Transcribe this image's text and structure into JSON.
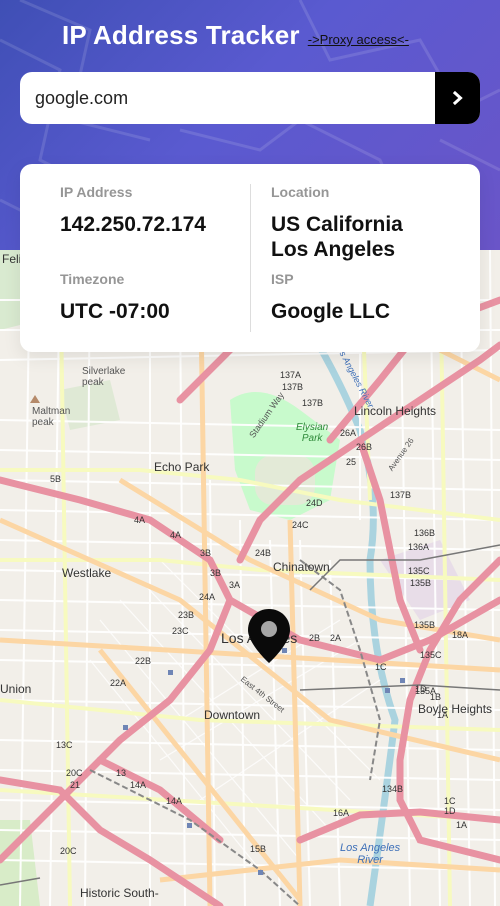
{
  "header": {
    "title": "IP Address Tracker",
    "proxy_link": "->Proxy access<-"
  },
  "search": {
    "value": "google.com",
    "button_icon": "chevron-right-icon"
  },
  "info": {
    "ip_label": "IP Address",
    "ip_value": "142.250.72.174",
    "location_label": "Location",
    "location_line1": "US California",
    "location_line2": "Los Angeles",
    "timezone_label": "Timezone",
    "timezone_value": "UTC -07:00",
    "isp_label": "ISP",
    "isp_value": "Google LLC"
  },
  "map": {
    "marker_icon": "location-pin-icon",
    "labels": {
      "feli": "Feli",
      "silverlake": "Silverlake\npeak",
      "maltman": "Maltman\npeak",
      "stadium_way": "Stadium Way",
      "elysian": "Elysian\nPark",
      "lincoln": "Lincoln Heights",
      "echo": "Echo Park",
      "westlake": "Westlake",
      "chinatown": "Chinatown",
      "los_angeles": "Los Angeles",
      "union": "Union",
      "downtown": "Downtown",
      "boyle": "Boyle Heights",
      "la_river": "Los Angeles\nRiver",
      "historic": "Historic South-",
      "east4th": "East 4th Street",
      "avenue26": "Avenue 26",
      "la_river_road": "Los Angeles River"
    },
    "exits": [
      "137A",
      "137B",
      "137B",
      "26A",
      "26B",
      "137B",
      "5B",
      "4A",
      "4A",
      "3B",
      "24B",
      "25",
      "24D",
      "24C",
      "136B",
      "136A",
      "3B",
      "3A",
      "24A",
      "135C",
      "135B",
      "23B",
      "23C",
      "22B",
      "2B",
      "2A",
      "1C",
      "135B",
      "135C",
      "18A",
      "22A",
      "1D",
      "1B",
      "1A",
      "135A",
      "13C",
      "21",
      "20C",
      "13",
      "14A",
      "14A",
      "16A",
      "134B",
      "1C",
      "1D",
      "1A",
      "15B",
      "20C"
    ],
    "colors": {
      "motorway": "#e892a2",
      "primary": "#fcd6a4",
      "secondary": "#f7fabf",
      "park": "#c8facc",
      "water": "#aad3df"
    }
  }
}
